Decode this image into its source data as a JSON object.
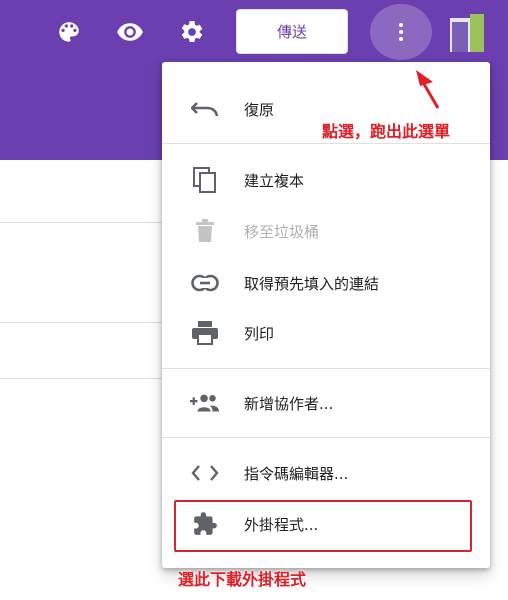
{
  "header": {
    "send_label": "傳送",
    "icons": [
      "palette-icon",
      "eye-icon",
      "gear-icon",
      "more-vert-icon"
    ],
    "theme_color": "#6b3fb0"
  },
  "menu": {
    "items": [
      {
        "label": "復原",
        "icon": "undo-icon",
        "enabled": true
      },
      {
        "label": "建立複本",
        "icon": "copy-icon",
        "enabled": true
      },
      {
        "label": "移至垃圾桶",
        "icon": "trash-icon",
        "enabled": false
      },
      {
        "label": "取得預先填入的連結",
        "icon": "link-icon",
        "enabled": true
      },
      {
        "label": "列印",
        "icon": "print-icon",
        "enabled": true
      },
      {
        "label": "新增協作者...",
        "icon": "add-people-icon",
        "enabled": true
      },
      {
        "label": "指令碼編輯器...",
        "icon": "code-icon",
        "enabled": true
      },
      {
        "label": "外掛程式...",
        "icon": "puzzle-icon",
        "enabled": true
      }
    ]
  },
  "annotations": {
    "top": "點選，跑出此選單",
    "bottom": "選此下載外掛程式",
    "color": "#e01f26"
  }
}
